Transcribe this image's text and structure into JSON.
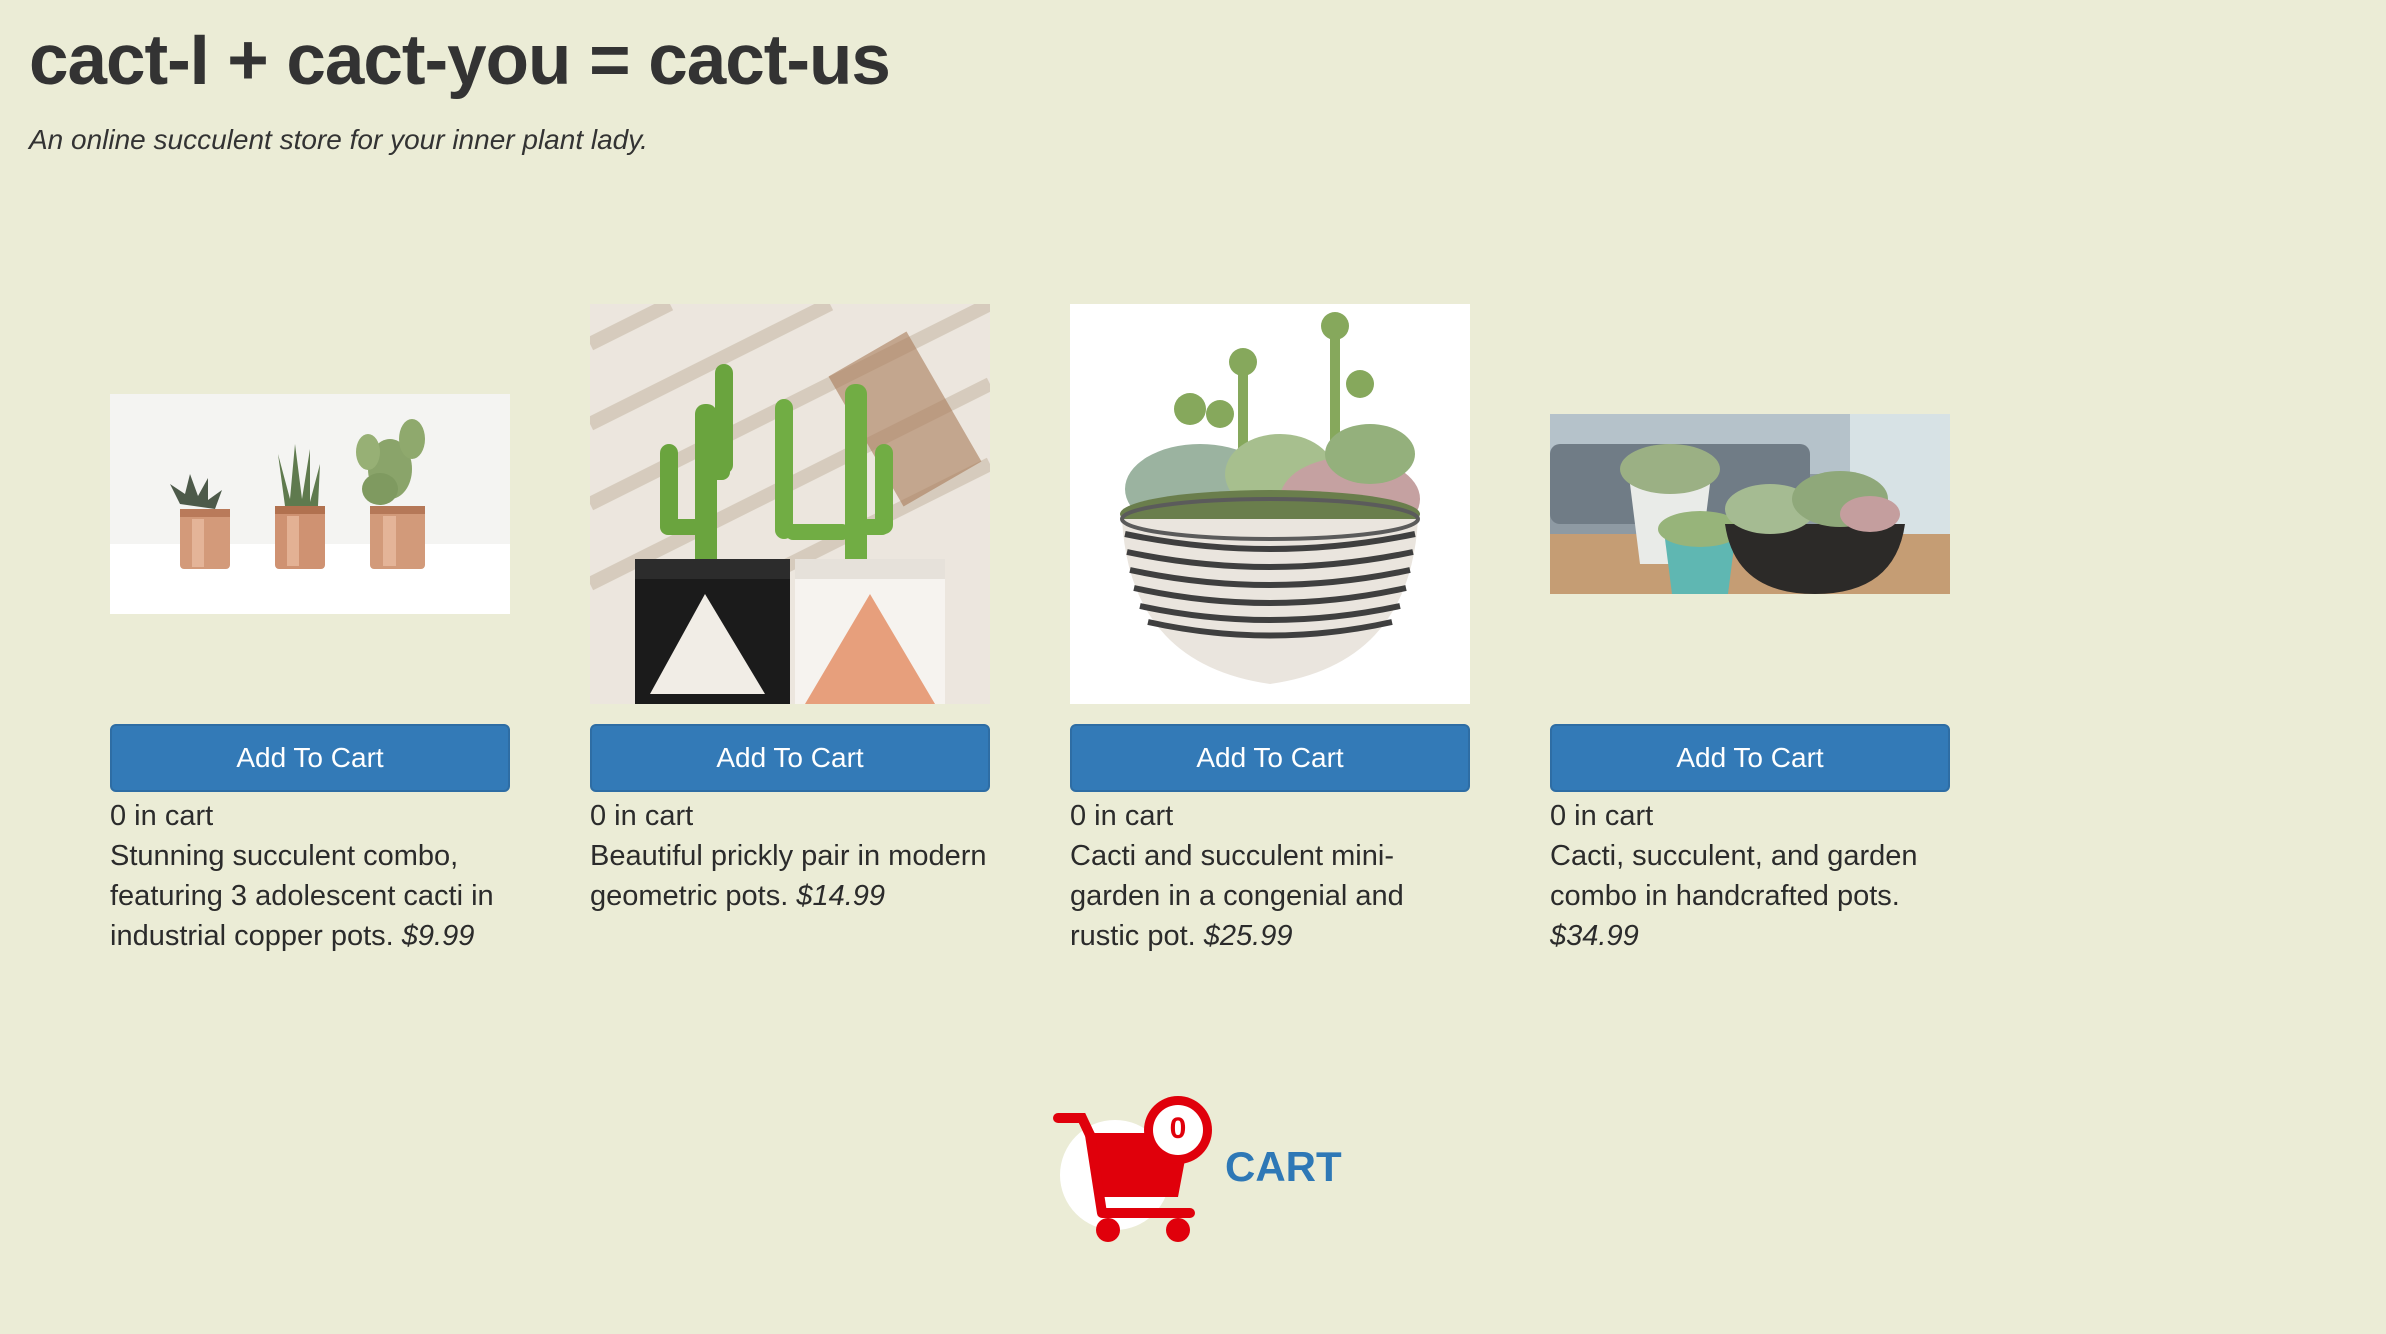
{
  "header": {
    "title": "cact-I + cact-you = cact-us",
    "tagline": "An online succulent store for your inner plant lady."
  },
  "products": [
    {
      "image_icon": "three-copper-pots-image",
      "button_label": "Add To Cart",
      "in_cart": "0 in cart",
      "description": "Stunning succulent combo, featuring 3 adolescent cacti in industrial copper pots.",
      "price": "$9.99"
    },
    {
      "image_icon": "prickly-pair-image",
      "button_label": "Add To Cart",
      "in_cart": "0 in cart",
      "description": "Beautiful prickly pair in modern geometric pots.",
      "price": "$14.99"
    },
    {
      "image_icon": "mini-garden-bowl-image",
      "button_label": "Add To Cart",
      "in_cart": "0 in cart",
      "description": "Cacti and succulent mini-garden in a congenial and rustic pot.",
      "price": "$25.99"
    },
    {
      "image_icon": "handcrafted-pots-image",
      "button_label": "Add To Cart",
      "in_cart": "0 in cart",
      "description": "Cacti, succulent, and garden combo in handcrafted pots.",
      "price": "$34.99"
    }
  ],
  "cart": {
    "label": "CART",
    "count": "0",
    "icon": "shopping-cart-icon"
  },
  "colors": {
    "background": "#ebecd6",
    "button": "#337ab7",
    "cart_red": "#e0000b",
    "cart_label": "#2e78b6"
  }
}
